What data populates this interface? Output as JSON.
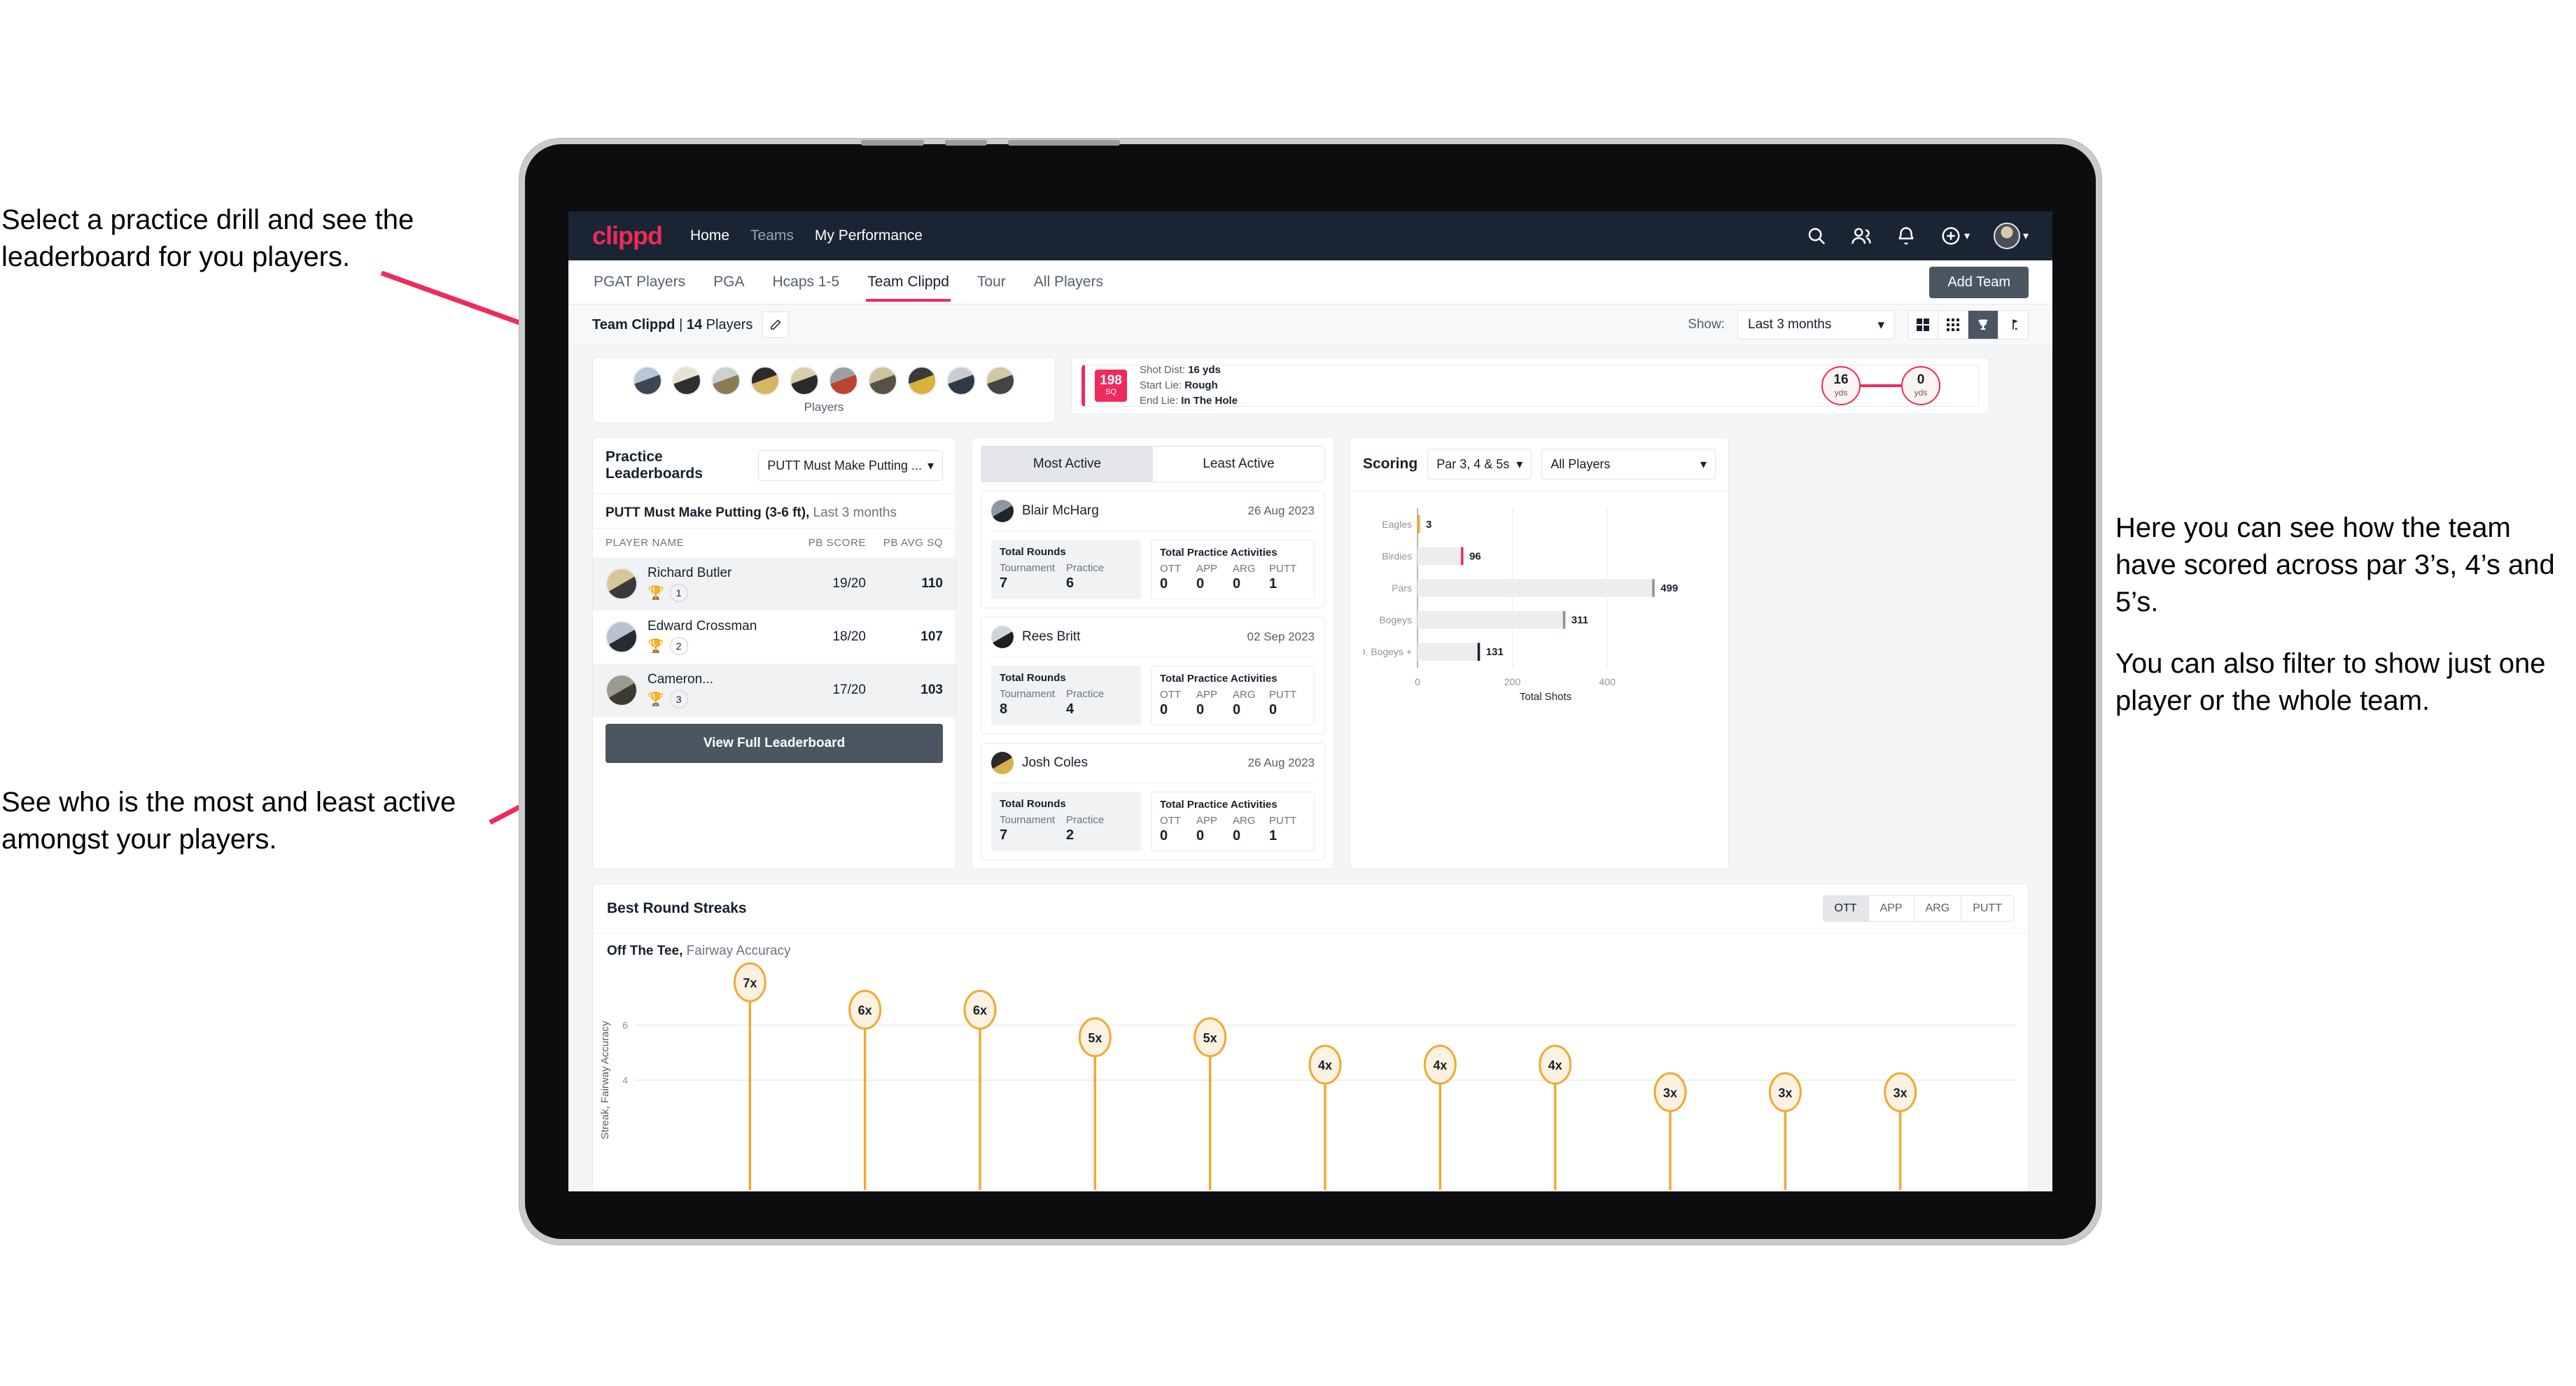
{
  "annotations": {
    "left_top": "Select a practice drill and see the leaderboard for you players.",
    "left_bottom": "See who is the most and least active amongst your players.",
    "right_1": "Here you can see how the team have scored across par 3’s, 4’s and 5’s.",
    "right_2": "You can also filter to show just one player or the whole team."
  },
  "colors": {
    "brand_pink": "#ef2a5c",
    "navbar": "#192532",
    "button_slate": "#4c5663",
    "amber": "#eeaa33"
  },
  "navbar": {
    "logo": "clippd",
    "links": [
      {
        "label": "Home",
        "active": true
      },
      {
        "label": "Teams",
        "active": false
      },
      {
        "label": "My Performance",
        "active": true
      }
    ],
    "icons": [
      "search-icon",
      "people-icon",
      "bell-icon",
      "plus-circle-icon",
      "avatar"
    ]
  },
  "tabs": [
    {
      "label": "PGAT Players",
      "active": false
    },
    {
      "label": "PGA",
      "active": false
    },
    {
      "label": "Hcaps 1-5",
      "active": false
    },
    {
      "label": "Team Clippd",
      "active": true
    },
    {
      "label": "Tour",
      "active": false
    },
    {
      "label": "All Players",
      "active": false
    }
  ],
  "add_team_button": "Add Team",
  "toolbar": {
    "team_name": "Team Clippd",
    "team_separator": "|",
    "player_count": "14",
    "players_word": "Players",
    "show_label": "Show:",
    "range_value": "Last 3 months",
    "view_buttons": [
      "grid-large-icon",
      "grid-small-icon",
      "trophy-icon",
      "flag-icon"
    ],
    "active_view_index": 2
  },
  "players_card": {
    "caption": "Players",
    "avatar_count": 10
  },
  "shot_card": {
    "sq_value": "198",
    "sq_unit": "SQ",
    "lines": [
      {
        "label": "Shot Dist:",
        "value": "16 yds"
      },
      {
        "label": "Start Lie:",
        "value": "Rough"
      },
      {
        "label": "End Lie:",
        "value": "In The Hole"
      }
    ],
    "start_distance": "16",
    "start_unit": "yds",
    "end_distance": "0",
    "end_unit": "yds"
  },
  "leaderboard": {
    "title": "Practice Leaderboards",
    "drill_select": "PUTT Must Make Putting ...",
    "subtitle_bold": "PUTT Must Make Putting (3-6 ft),",
    "subtitle_light": "Last 3 months",
    "columns": [
      "PLAYER NAME",
      "PB SCORE",
      "PB AVG SQ"
    ],
    "rows": [
      {
        "name": "Richard Butler",
        "rank": "1",
        "trophy": "gold",
        "pb_score": "19/20",
        "pb_avg_sq": "110"
      },
      {
        "name": "Edward Crossman",
        "rank": "2",
        "trophy": "silver",
        "pb_score": "18/20",
        "pb_avg_sq": "107"
      },
      {
        "name": "Cameron...",
        "rank": "3",
        "trophy": "bronze",
        "pb_score": "17/20",
        "pb_avg_sq": "103"
      }
    ],
    "view_full_button": "View Full Leaderboard"
  },
  "activity": {
    "tabs": [
      {
        "label": "Most Active",
        "active": true
      },
      {
        "label": "Least Active",
        "active": false
      }
    ],
    "rounds_title": "Total Rounds",
    "practice_title": "Total Practice Activities",
    "rounds_keys": [
      "Tournament",
      "Practice"
    ],
    "practice_keys": [
      "OTT",
      "APP",
      "ARG",
      "PUTT"
    ],
    "players": [
      {
        "name": "Blair McHarg",
        "date": "26 Aug 2023",
        "tournament": "7",
        "practice": "6",
        "ott": "0",
        "app": "0",
        "arg": "0",
        "putt": "1"
      },
      {
        "name": "Rees Britt",
        "date": "02 Sep 2023",
        "tournament": "8",
        "practice": "4",
        "ott": "0",
        "app": "0",
        "arg": "0",
        "putt": "0"
      },
      {
        "name": "Josh Coles",
        "date": "26 Aug 2023",
        "tournament": "7",
        "practice": "2",
        "ott": "0",
        "app": "0",
        "arg": "0",
        "putt": "1"
      }
    ]
  },
  "scoring": {
    "title": "Scoring",
    "par_select": "Par 3, 4 & 5s",
    "player_select": "All Players"
  },
  "streaks": {
    "title": "Best Round Streaks",
    "metric_tabs": [
      {
        "label": "OTT",
        "active": true
      },
      {
        "label": "APP",
        "active": false
      },
      {
        "label": "ARG",
        "active": false
      },
      {
        "label": "PUTT",
        "active": false
      }
    ],
    "subtitle_bold": "Off The Tee,",
    "subtitle_light": "Fairway Accuracy"
  },
  "chart_data": [
    {
      "type": "bar",
      "orientation": "horizontal",
      "title": "Scoring",
      "categories": [
        "Eagles",
        "Birdies",
        "Pars",
        "Bogeys",
        "D. Bogeys +"
      ],
      "values": [
        3,
        96,
        499,
        311,
        131
      ],
      "bar_end_colors": [
        "#eeaa33",
        "#ef2a5c",
        "#8d939b",
        "#8d939b",
        "#16202c"
      ],
      "xlabel": "Total Shots",
      "ylabel": "",
      "xticks": [
        0,
        200,
        400
      ],
      "xlim": [
        0,
        540
      ],
      "grid": true,
      "legend": "none"
    },
    {
      "type": "bar",
      "orientation": "vertical-lollipop",
      "title": "Best Round Streaks",
      "subtitle": "Off The Tee, Fairway Accuracy",
      "categories": [
        "1",
        "2",
        "3",
        "4",
        "5",
        "6",
        "7",
        "8",
        "9",
        "10",
        "11"
      ],
      "values": [
        7,
        6,
        6,
        5,
        5,
        4,
        4,
        4,
        3,
        3,
        3
      ],
      "labels": [
        "7x",
        "6x",
        "6x",
        "5x",
        "5x",
        "4x",
        "4x",
        "4x",
        "3x",
        "3x",
        "3x"
      ],
      "ylabel": "Streak, Fairway Accuracy",
      "yticks": [
        4,
        6
      ],
      "ylim": [
        0,
        8
      ],
      "grid": true,
      "marker_color": "#eeaa33",
      "marker_fill": "#fdf2e2"
    }
  ]
}
